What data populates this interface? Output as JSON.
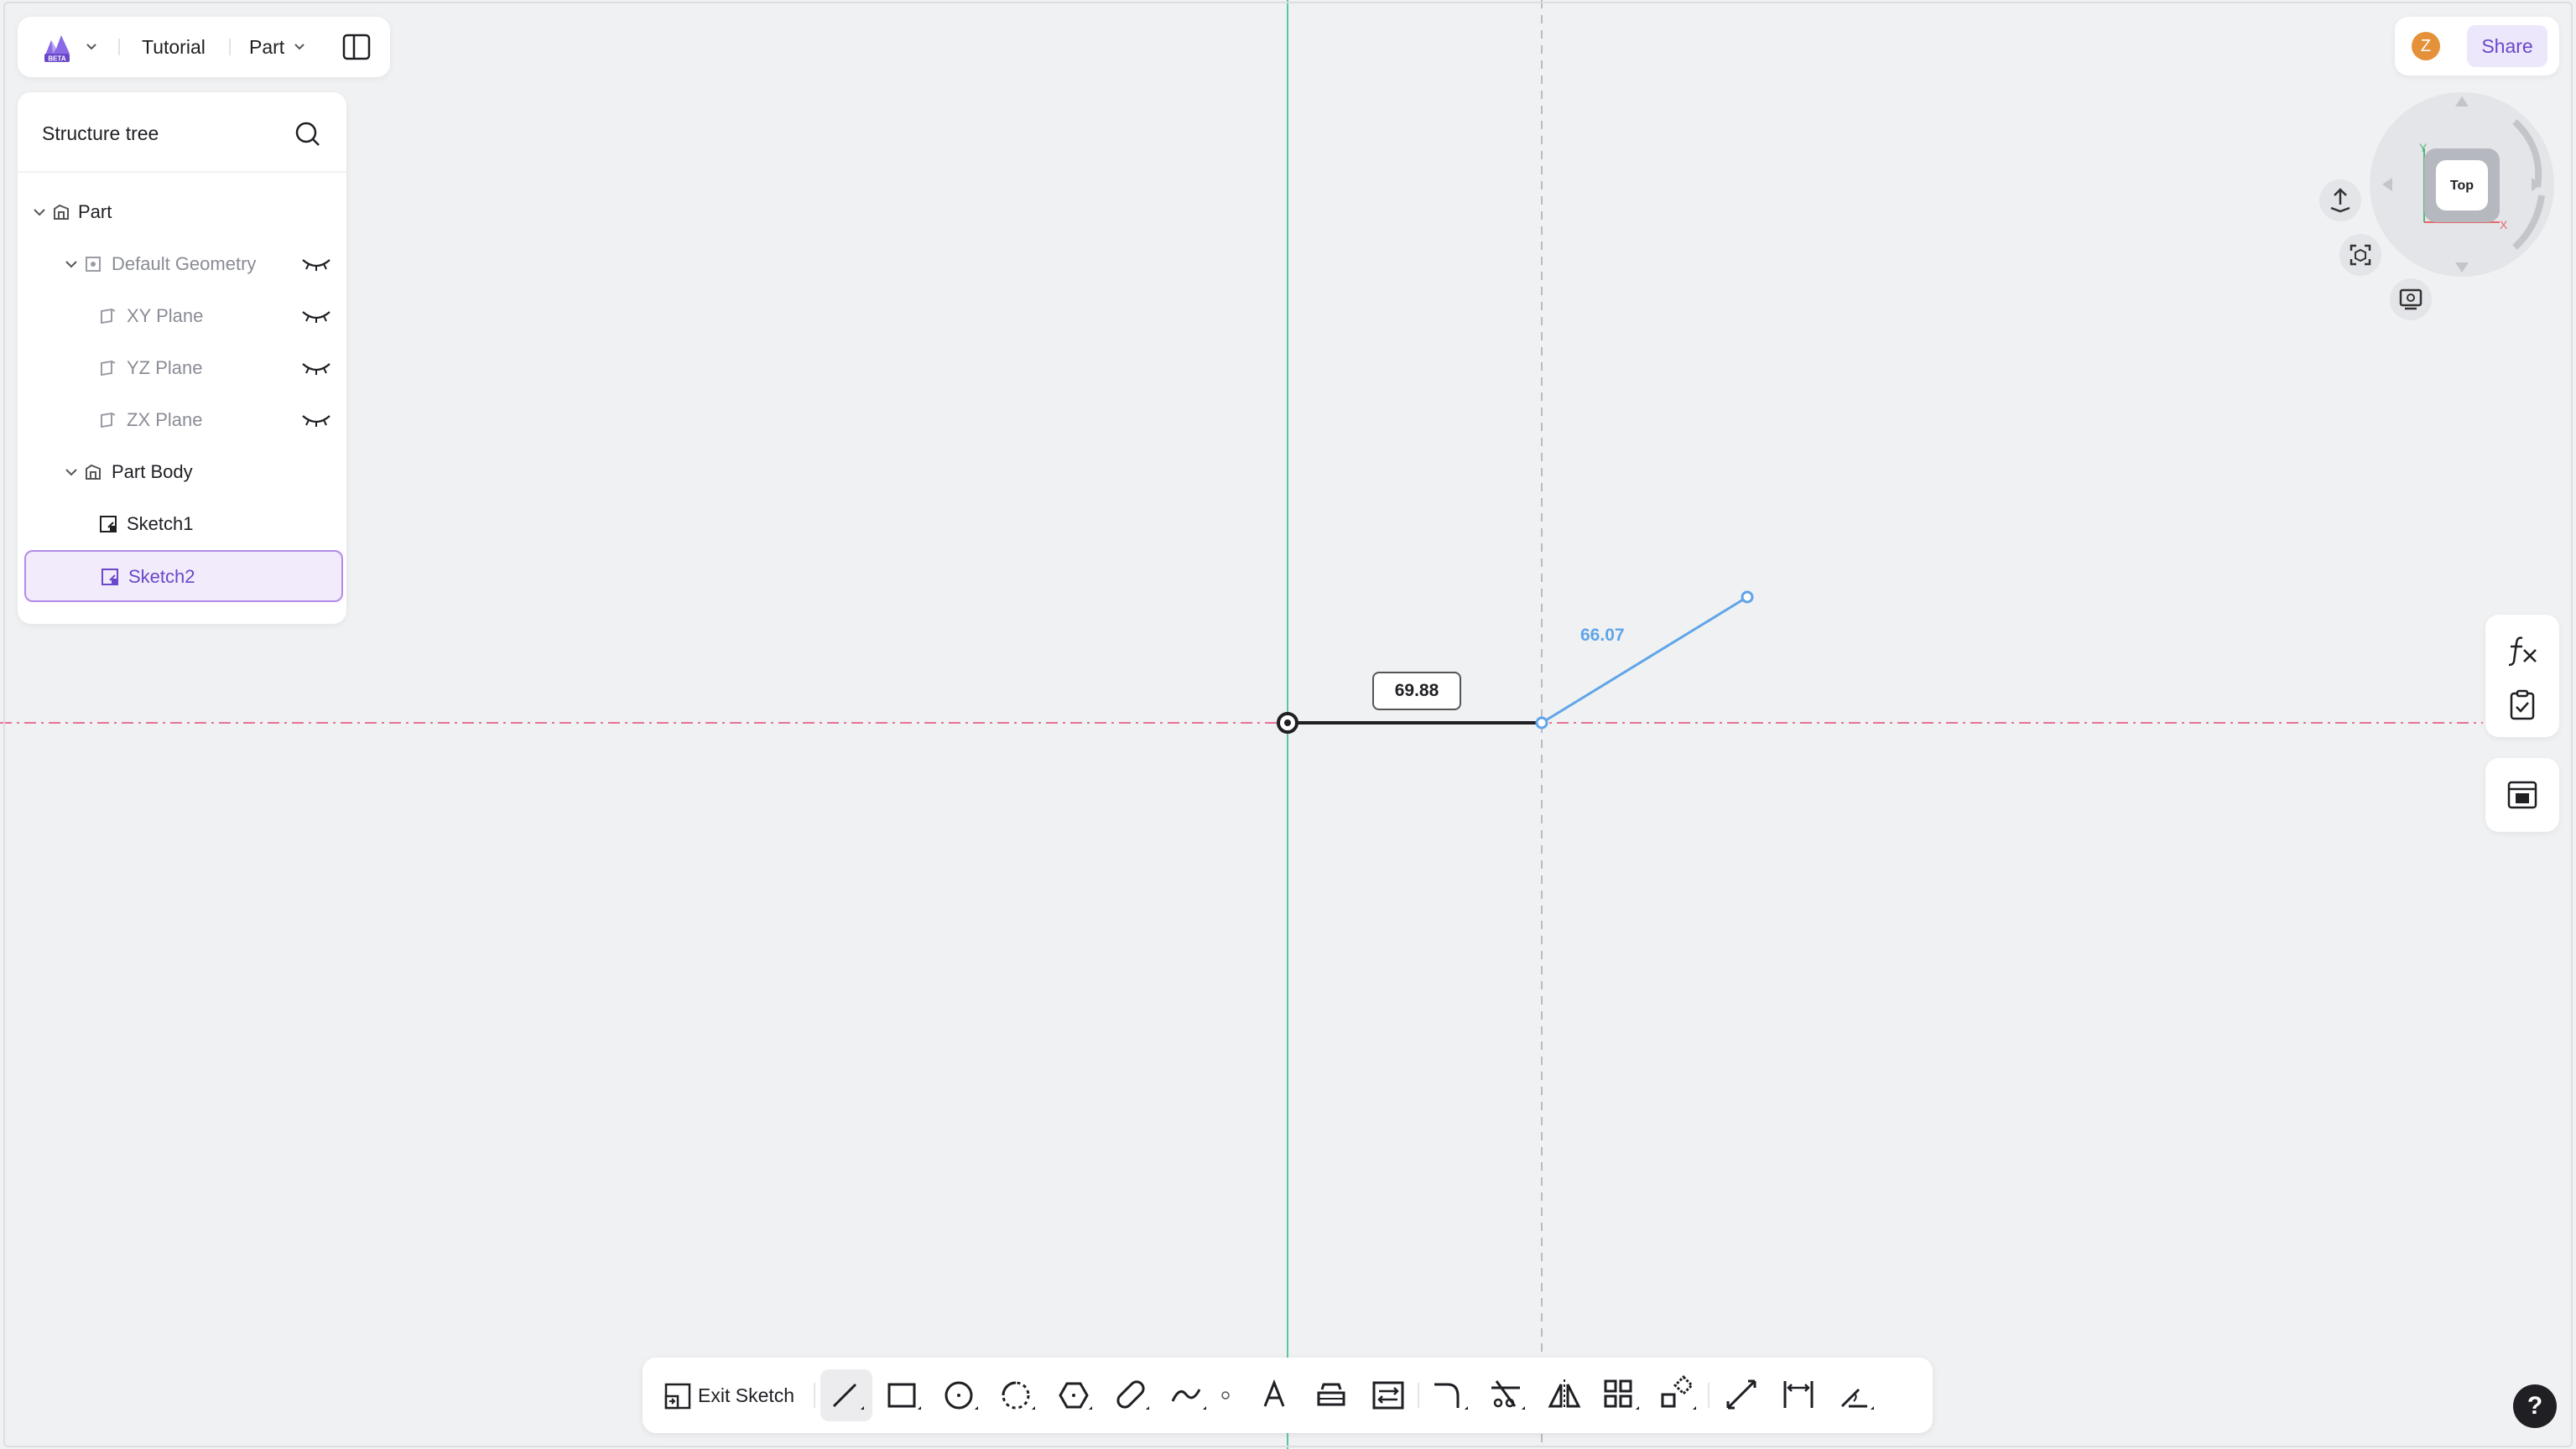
{
  "header": {
    "logo_badge": "BETA",
    "project": "Tutorial",
    "mode": "Part"
  },
  "tree": {
    "title": "Structure tree",
    "items": [
      {
        "label": "Part"
      },
      {
        "label": "Default Geometry"
      },
      {
        "label": "XY Plane"
      },
      {
        "label": "YZ Plane"
      },
      {
        "label": "ZX Plane"
      },
      {
        "label": "Part Body"
      },
      {
        "label": "Sketch1"
      },
      {
        "label": "Sketch2",
        "selected": true
      }
    ]
  },
  "topright": {
    "avatar_initial": "Z",
    "share_label": "Share"
  },
  "viewcube": {
    "face_label": "Top",
    "axis_y": "Y",
    "axis_x": "X"
  },
  "sketch": {
    "fixed_dimension": "69.88",
    "live_dimension": "66.07"
  },
  "toolbar": {
    "exit_label": "Exit Sketch"
  },
  "help_label": "?",
  "colors": {
    "accent": "#6b47c9",
    "selection_bg": "#f1ebfb",
    "axis_vertical": "#5cc5a0",
    "axis_horizontal": "#e57393",
    "live_line": "#5fa5e8",
    "fixed_line": "#1f1f24"
  }
}
